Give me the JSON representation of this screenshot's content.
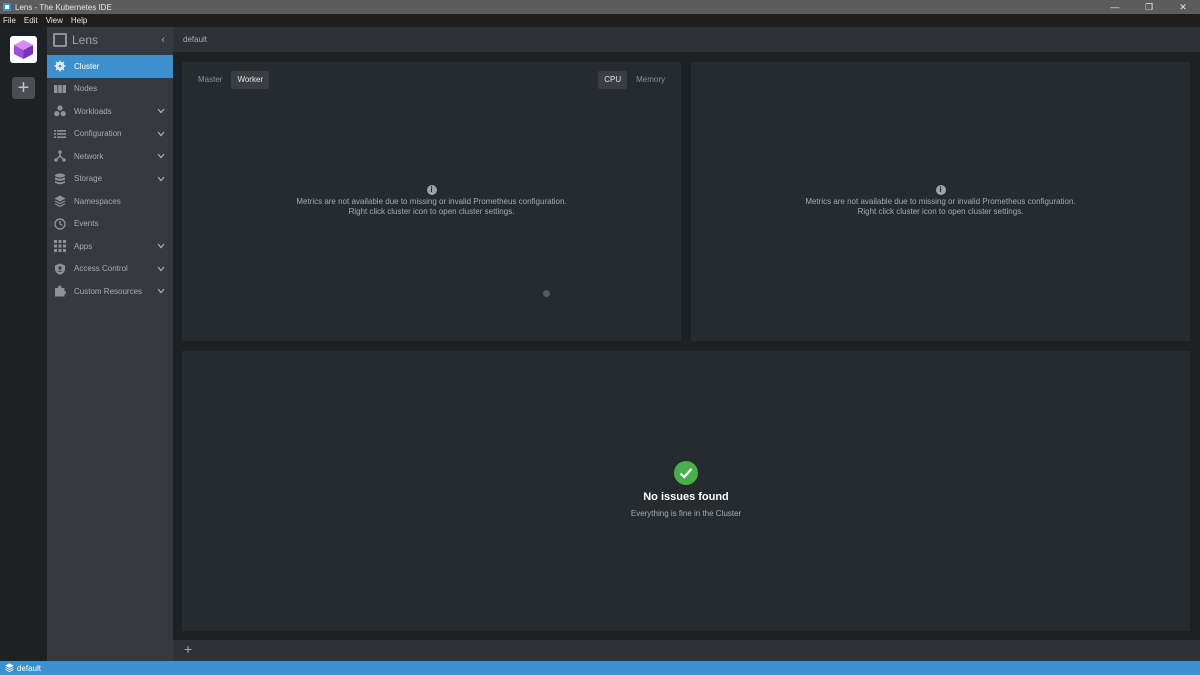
{
  "window": {
    "title": "Lens - The Kubernetes IDE",
    "min": "—",
    "restore": "❐",
    "close": "✕"
  },
  "menu": [
    "File",
    "Edit",
    "View",
    "Help"
  ],
  "sidebar": {
    "title": "Lens",
    "items": [
      {
        "label": "Cluster",
        "icon": "helm-wheel-icon"
      },
      {
        "label": "Nodes",
        "icon": "nodes-icon"
      },
      {
        "label": "Workloads",
        "icon": "workloads-icon"
      },
      {
        "label": "Configuration",
        "icon": "list-icon"
      },
      {
        "label": "Network",
        "icon": "network-icon"
      },
      {
        "label": "Storage",
        "icon": "storage-icon"
      },
      {
        "label": "Namespaces",
        "icon": "layers-icon"
      },
      {
        "label": "Events",
        "icon": "clock-icon"
      },
      {
        "label": "Apps",
        "icon": "apps-grid-icon"
      },
      {
        "label": "Access Control",
        "icon": "shield-icon"
      },
      {
        "label": "Custom Resources",
        "icon": "puzzle-icon"
      }
    ]
  },
  "main": {
    "breadcrumb": "default",
    "tabs_left": [
      "Master",
      "Worker"
    ],
    "tabs_right": [
      "CPU",
      "Memory"
    ],
    "metrics_line1": "Metrics are not available due to missing or invalid Prometheus configuration.",
    "metrics_line2": "Right click cluster icon to open cluster settings.",
    "issues_title": "No issues found",
    "issues_sub": "Everything is fine in the Cluster"
  },
  "status": {
    "cluster": "default"
  },
  "colors": {
    "accent": "#3d90ce",
    "success": "#48b04b"
  }
}
